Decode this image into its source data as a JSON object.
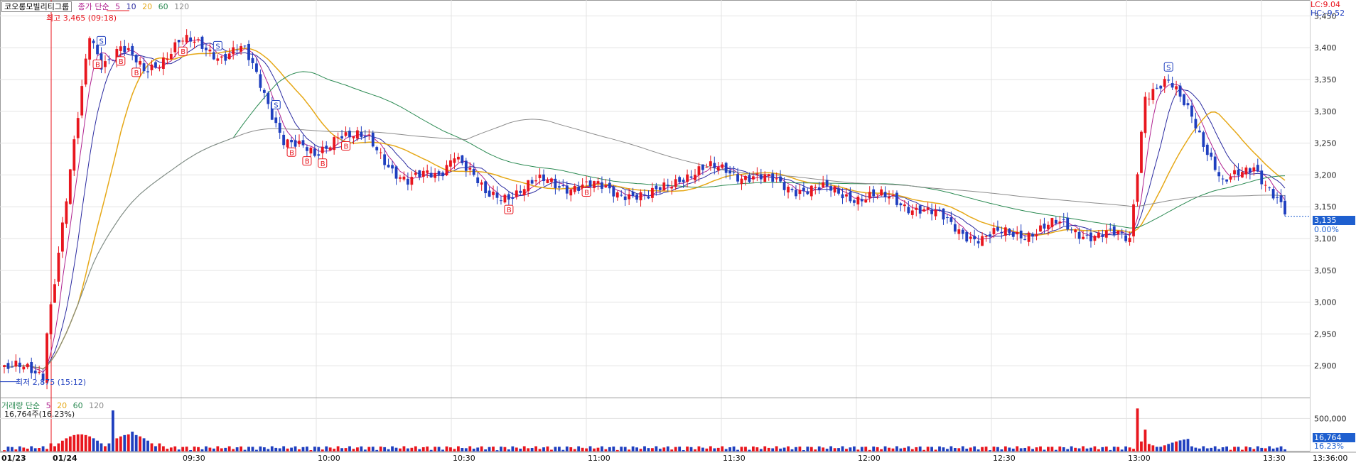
{
  "symbol": "코오롱모빌리티그룹",
  "price_legend": {
    "label": "종가 단순",
    "periods": [
      "5",
      "10",
      "20",
      "60",
      "120"
    ]
  },
  "volume_legend": {
    "label": "거래량 단순",
    "periods": [
      "5",
      "20",
      "60",
      "120"
    ],
    "info": "16,764주(16.23%)"
  },
  "corner": {
    "lc": "LC:9.04",
    "hc": "HC:-9.52"
  },
  "annotations": {
    "high": "최고 3,465 (09:18)",
    "low": "최저 2,875 (15:12)"
  },
  "current_price_label": "3,135",
  "current_change_label": "0.00%",
  "current_volume_label": "16,764",
  "current_volume_pct_label": "16.23%",
  "colors": {
    "up": "#e8161e",
    "down": "#1f3fbf",
    "ma5": "#b0218f",
    "ma10": "#2a2aa0",
    "ma20": "#e6a817",
    "ma60": "#2b8a52",
    "ma120": "#8c8c8c",
    "current": "#1e5fcf"
  },
  "chart_data": [
    {
      "type": "candlestick",
      "ylim": [
        2850,
        3475
      ],
      "y_ticks": [
        "3,450",
        "3,400",
        "3,350",
        "3,300",
        "3,250",
        "3,200",
        "3,150",
        "3,100",
        "3,050",
        "3,000",
        "2,950",
        "2,900"
      ],
      "x_ticks": [
        "01/23",
        "01/24",
        "09:30",
        "10:00",
        "10:30",
        "11:00",
        "11:30",
        "12:00",
        "12:30",
        "13:00",
        "13:30",
        "13:36:00"
      ],
      "close_path": [
        [
          0,
          2895
        ],
        [
          10,
          2890
        ],
        [
          11,
          2960
        ],
        [
          14,
          3080
        ],
        [
          17,
          3200
        ],
        [
          20,
          3330
        ],
        [
          22,
          3420
        ],
        [
          25,
          3380
        ],
        [
          30,
          3400
        ],
        [
          36,
          3360
        ],
        [
          45,
          3410
        ],
        [
          56,
          3390
        ],
        [
          60,
          3400
        ],
        [
          62,
          3390
        ],
        [
          66,
          3340
        ],
        [
          72,
          3260
        ],
        [
          80,
          3225
        ],
        [
          86,
          3270
        ],
        [
          94,
          3250
        ],
        [
          104,
          3190
        ],
        [
          112,
          3200
        ],
        [
          116,
          3240
        ],
        [
          118,
          3220
        ],
        [
          124,
          3165
        ],
        [
          132,
          3175
        ],
        [
          140,
          3190
        ],
        [
          150,
          3180
        ],
        [
          160,
          3175
        ],
        [
          166,
          3160
        ],
        [
          174,
          3200
        ],
        [
          186,
          3210
        ],
        [
          196,
          3190
        ],
        [
          210,
          3175
        ],
        [
          224,
          3165
        ],
        [
          236,
          3150
        ],
        [
          244,
          3120
        ],
        [
          252,
          3100
        ],
        [
          262,
          3110
        ],
        [
          272,
          3120
        ],
        [
          282,
          3105
        ],
        [
          290,
          3100
        ],
        [
          294,
          3330
        ],
        [
          300,
          3340
        ],
        [
          306,
          3300
        ],
        [
          314,
          3180
        ],
        [
          322,
          3220
        ],
        [
          330,
          3135
        ]
      ],
      "buy_signals": [
        2,
        4,
        6,
        8,
        10,
        12
      ],
      "sell_signals": [
        1,
        3,
        5,
        11
      ],
      "volume": {
        "ytick": "500,000",
        "spikes": [
          [
            22,
            680000
          ],
          [
            25,
            300000
          ],
          [
            5,
            120000
          ],
          [
            290,
            700000
          ],
          [
            292,
            400000
          ]
        ]
      }
    }
  ]
}
